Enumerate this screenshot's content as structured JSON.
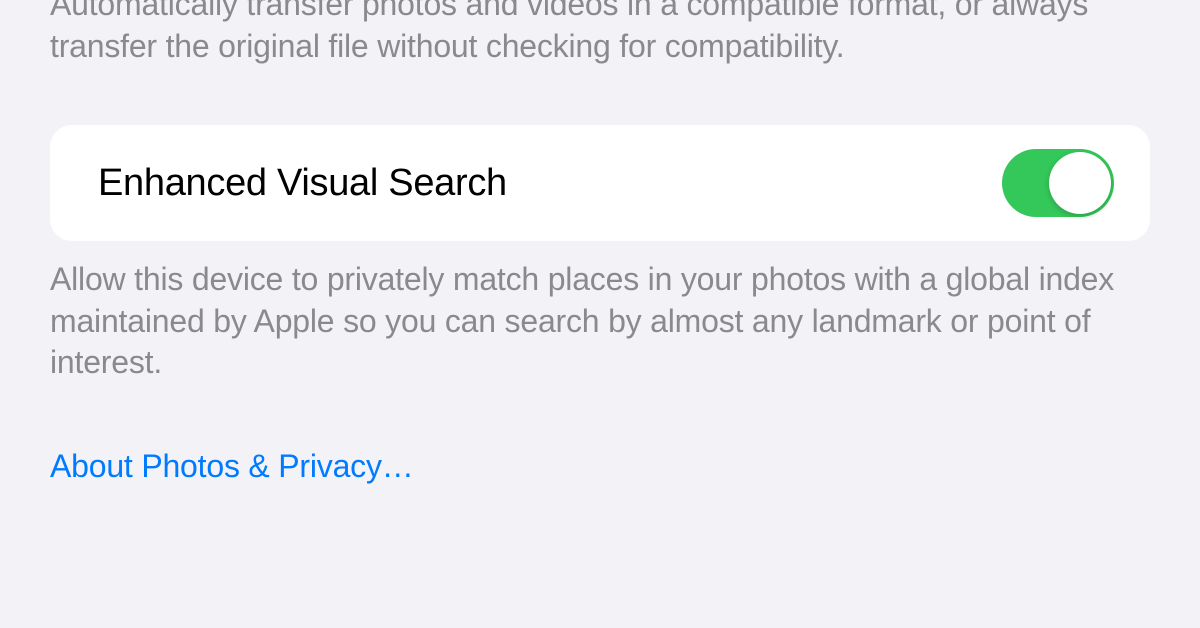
{
  "transfer": {
    "description": "Automatically transfer photos and videos in a compatible format, or always transfer the original file without checking for compatibility."
  },
  "enhancedVisualSearch": {
    "label": "Enhanced Visual Search",
    "enabled": true,
    "description": "Allow this device to privately match places in your photos with a global index maintained by Apple so you can search by almost any landmark or point of interest."
  },
  "privacyLink": {
    "label": "About Photos & Privacy…"
  },
  "colors": {
    "background": "#f2f2f7",
    "cardBackground": "#ffffff",
    "secondaryText": "#8a8a8e",
    "primaryText": "#000000",
    "link": "#007aff",
    "toggleOn": "#34c759"
  }
}
